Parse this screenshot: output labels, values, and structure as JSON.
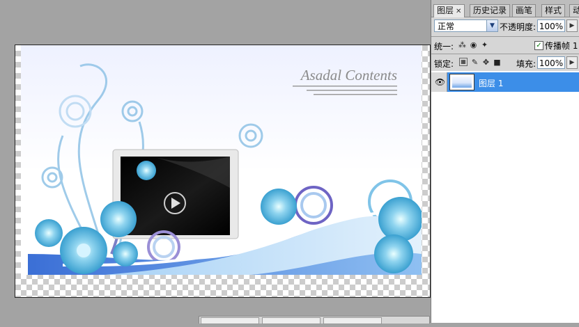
{
  "canvas": {
    "artwork_title": "Asadal Contents",
    "colors": {
      "background": "#a3a3a3",
      "accent_blue": "#3c8ee8"
    }
  },
  "layers_panel": {
    "tabs": [
      {
        "label": "图层",
        "close": "✕"
      },
      {
        "label": "历史记录"
      },
      {
        "label": "画笔"
      },
      {
        "label": "样式"
      },
      {
        "label": "动"
      }
    ],
    "blend_mode": "正常",
    "opacity_label": "不透明度:",
    "opacity_value": "100%",
    "unify_label": "统一:",
    "propagate_label": "传播帧 1",
    "lock_label": "锁定:",
    "fill_label": "填充:",
    "fill_value": "100%",
    "layers": [
      {
        "name": "图层 1",
        "visible": true,
        "selected": true
      }
    ],
    "icons": {
      "visibility": "eye-icon",
      "unify_position": "unify-position-icon",
      "unify_visibility": "unify-visibility-icon",
      "unify_style": "unify-style-icon",
      "lock_transparent": "lock-transparent-icon",
      "lock_pixels": "brush-icon",
      "lock_position": "move-icon",
      "lock_all": "padlock-icon"
    }
  }
}
